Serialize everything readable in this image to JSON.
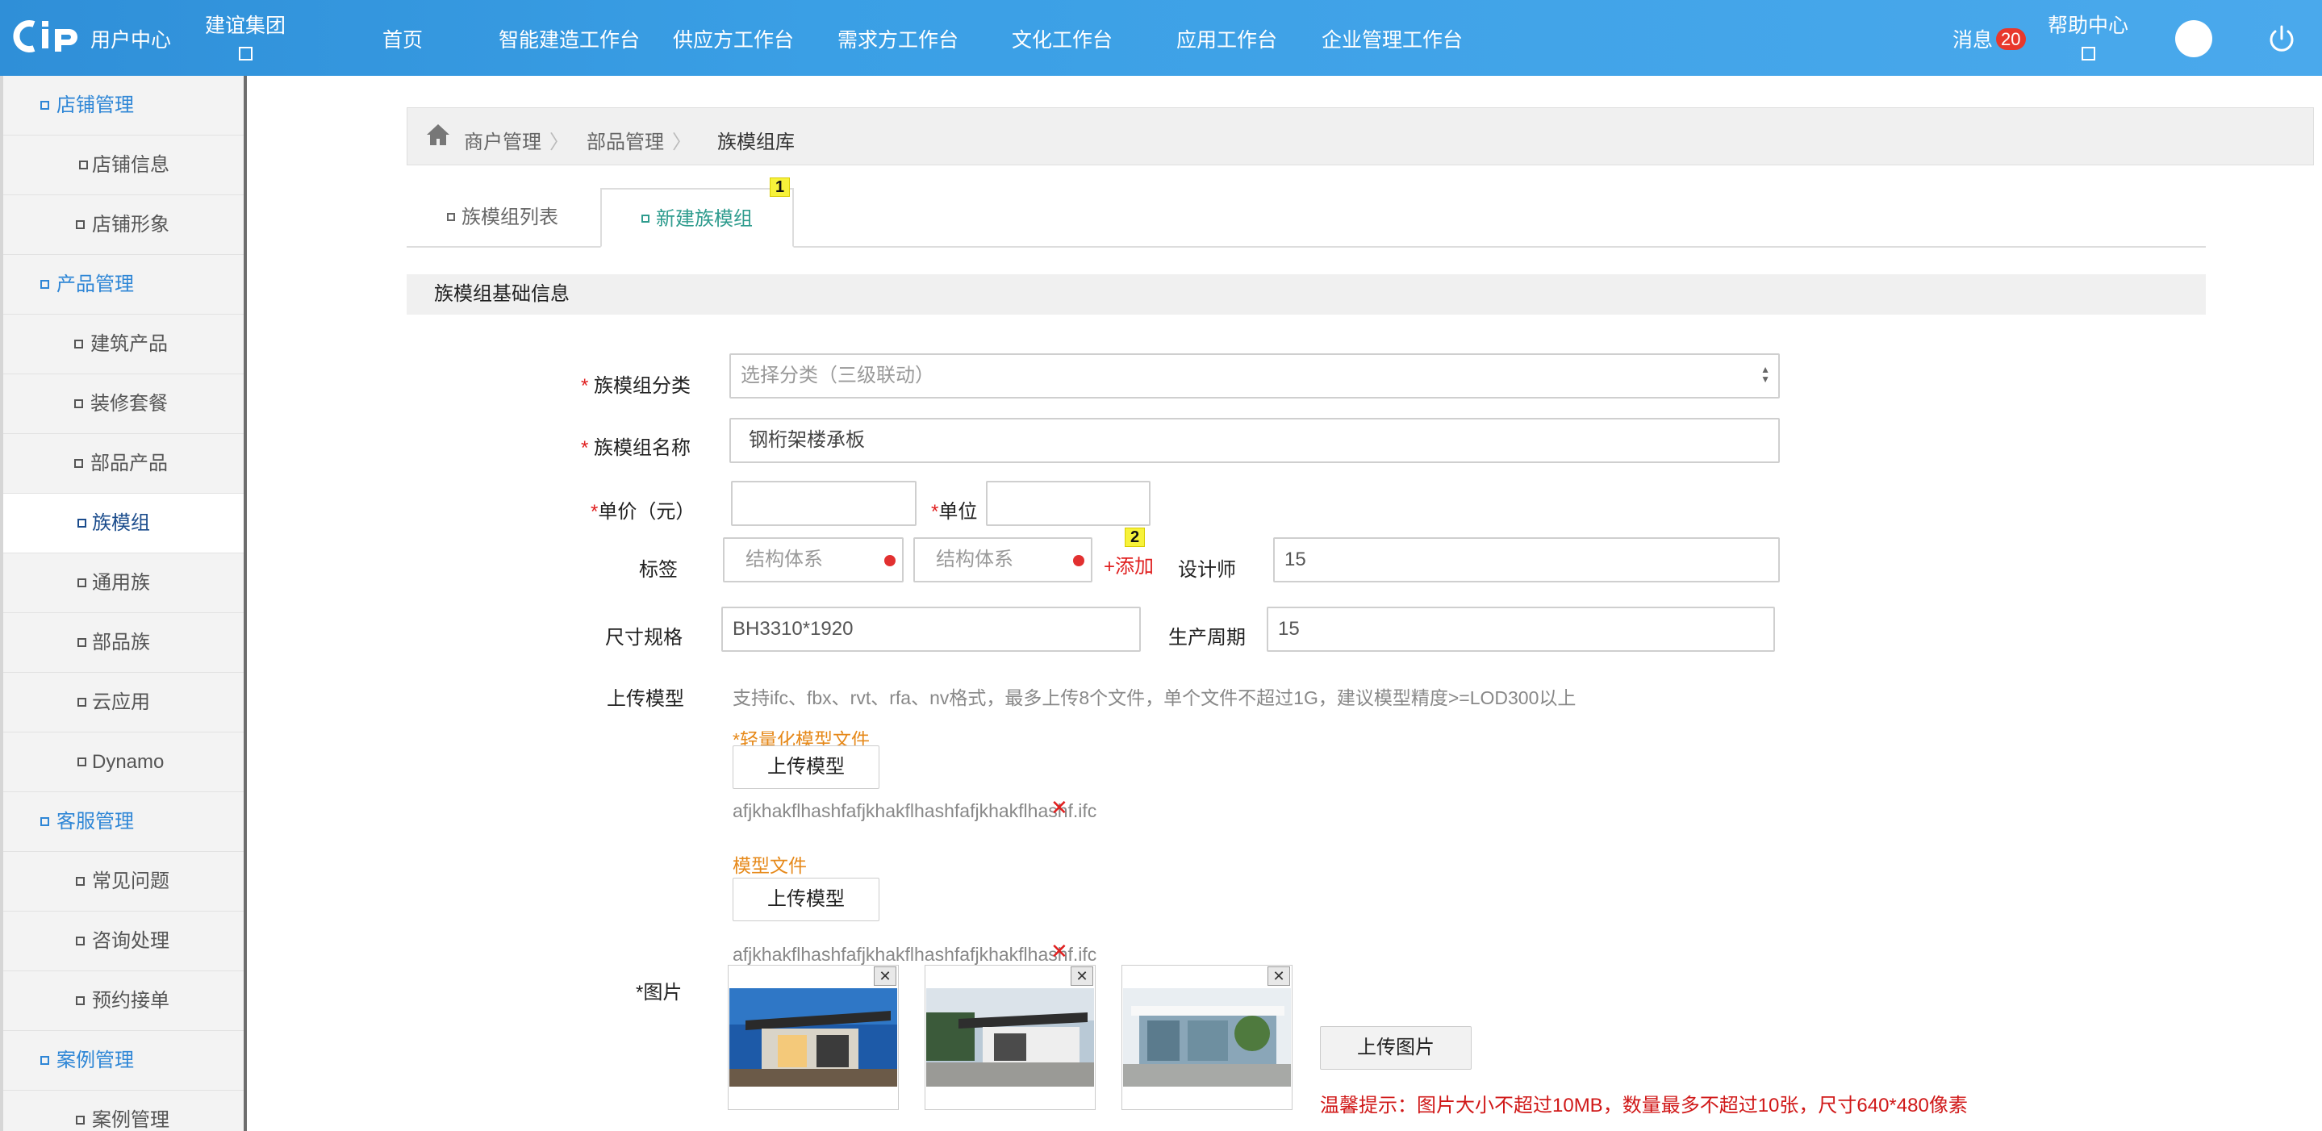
{
  "header": {
    "logo_text": "用户中心",
    "group": "建谊集团",
    "nav": [
      "首页",
      "智能建造工作台",
      "供应方工作台",
      "需求方工作台",
      "文化工作台",
      "应用工作台",
      "企业管理工作台"
    ],
    "messages_label": "消息",
    "messages_count": "20",
    "help_label": "帮助中心"
  },
  "sidebar": {
    "items": [
      {
        "label": "店铺管理"
      },
      {
        "label": "店铺信息"
      },
      {
        "label": "店铺形象"
      },
      {
        "label": "产品管理"
      },
      {
        "label": "建筑产品"
      },
      {
        "label": "装修套餐"
      },
      {
        "label": "部品产品"
      },
      {
        "label": "族模组"
      },
      {
        "label": "通用族"
      },
      {
        "label": "部品族"
      },
      {
        "label": "云应用"
      },
      {
        "label": "Dynamo"
      },
      {
        "label": "客服管理"
      },
      {
        "label": "常见问题"
      },
      {
        "label": "咨询处理"
      },
      {
        "label": "预约接单"
      },
      {
        "label": "案例管理"
      },
      {
        "label": "案例管理"
      }
    ]
  },
  "breadcrumb": [
    "商户管理",
    "部品管理",
    "族模组库"
  ],
  "tabs": {
    "list": "族模组列表",
    "new": "新建族模组",
    "marker1": "1",
    "marker2": "2"
  },
  "section_title": "族模组基础信息",
  "form": {
    "category_label": "族模组分类",
    "category_placeholder": "选择分类（三级联动）",
    "name_label": "族模组名称",
    "name_value": "钢桁架楼承板",
    "price_label": "单价（元）",
    "unit_label": "单位",
    "tag_label": "标签",
    "tag1": "结构体系",
    "tag2": "结构体系",
    "add_label": "+添加",
    "designer_label": "设计师",
    "designer_value": "15",
    "size_label": "尺寸规格",
    "size_value": "BH3310*1920",
    "cycle_label": "生产周期",
    "cycle_value": "15",
    "upload_label": "上传模型",
    "upload_hint": "支持ifc、fbx、rvt、rfa、nv格式，最多上传8个文件，单个文件不超过1G，建议模型精度>=LOD300以上",
    "light_model_label": "*轻量化模型文件",
    "upload_btn": "上传模型",
    "file1": "afjkhakflhashfafjkhakflhashfafjkhakflhashf.ifc",
    "model_file_label": "模型文件",
    "upload_btn2": "上传模型",
    "file2": "afjkhakflhashfafjkhakflhashfafjkhakflhashf.ifc",
    "image_label": "*图片",
    "upload_image_btn": "上传图片",
    "warning": "温馨提示：图片大小不超过10MB，数量最多不超过10张，尺寸640*480像素"
  }
}
